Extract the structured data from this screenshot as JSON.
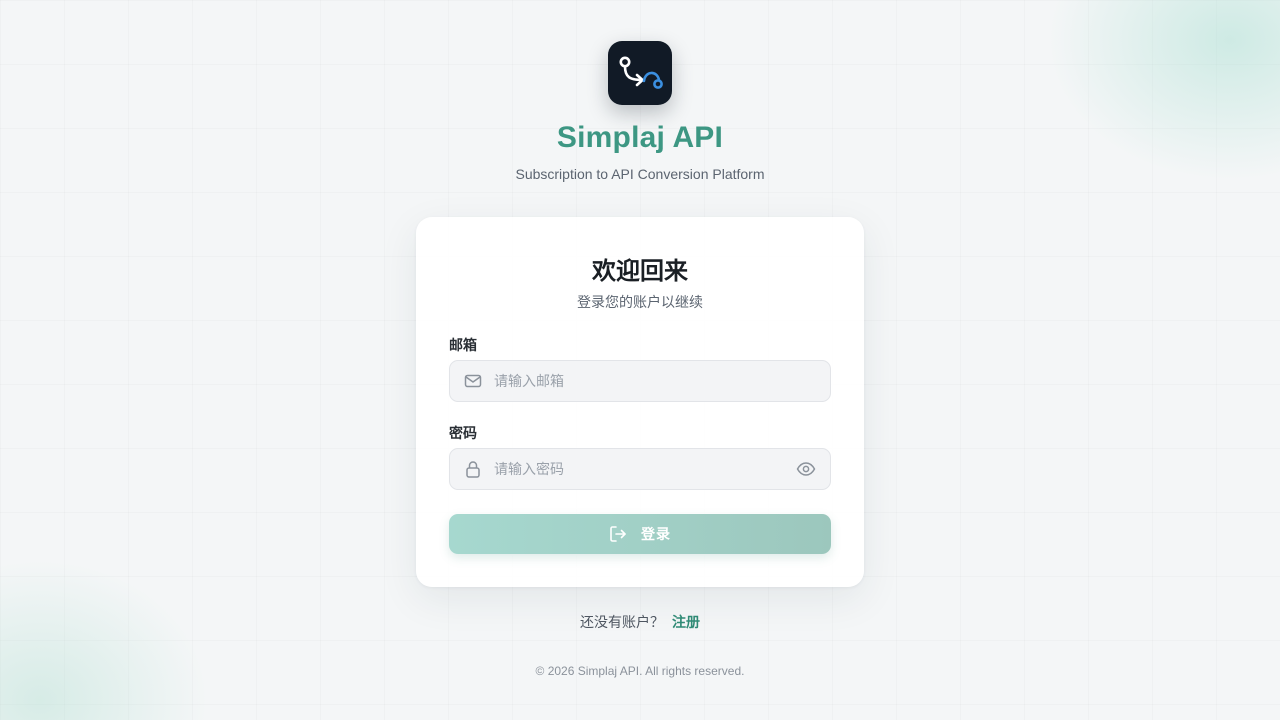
{
  "app": {
    "title": "Simplaj API",
    "subtitle": "Subscription to API Conversion Platform"
  },
  "card": {
    "title": "欢迎回来",
    "subtitle": "登录您的账户以继续"
  },
  "email": {
    "label": "邮箱",
    "placeholder": "请输入邮箱",
    "value": "",
    "icon": "mail-icon"
  },
  "password": {
    "label": "密码",
    "placeholder": "请输入密码",
    "value": "",
    "icon": "lock-icon",
    "toggle_icon": "eye-icon"
  },
  "login_button": {
    "label": "登录",
    "icon": "login-icon"
  },
  "register": {
    "prompt": "还没有账户？",
    "link_label": "注册"
  },
  "footer": {
    "copyright": "© 2026 Simplaj API. All rights reserved."
  },
  "colors": {
    "brand": "#3d9783",
    "link": "#2f8a75",
    "button_start": "#a6d8cf",
    "button_end": "#9cc7bd",
    "logo_bg": "#111a26"
  }
}
